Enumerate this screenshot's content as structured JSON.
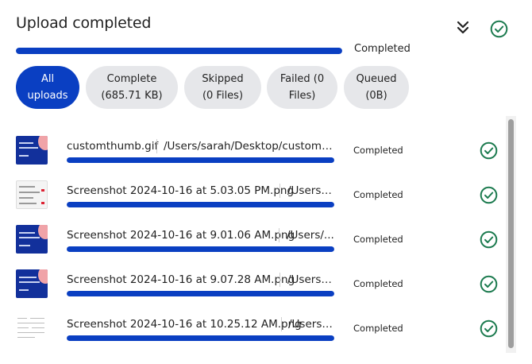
{
  "header": {
    "title": "Upload completed",
    "collapse_icon": "double-chevron-down-icon",
    "status_icon": "check-circle-icon"
  },
  "overall": {
    "progress_percent": 100,
    "status": "Completed"
  },
  "tabs": [
    {
      "line1": "All",
      "line2": "uploads",
      "active": true
    },
    {
      "line1": "Complete",
      "line2": "(685.71 KB)",
      "active": false
    },
    {
      "line1": "Skipped",
      "line2": "(0 Files)",
      "active": false
    },
    {
      "line1": "Failed (0",
      "line2": "Files)",
      "active": false
    },
    {
      "line1": "Queued",
      "line2": "(0B)",
      "active": false
    }
  ],
  "files": [
    {
      "name": "customthumb.gif",
      "path": "/Users/sarah/Desktop/customth...",
      "progress_percent": 100,
      "status": "Completed",
      "icon": "check-circle-icon"
    },
    {
      "name": "Screenshot 2024-10-16 at 5.03.05 PM.png",
      "path": "/Users/...",
      "progress_percent": 100,
      "status": "Completed",
      "icon": "check-circle-icon"
    },
    {
      "name": "Screenshot 2024-10-16 at 9.01.06 AM.png",
      "path": "/Users/...",
      "progress_percent": 100,
      "status": "Completed",
      "icon": "check-circle-icon"
    },
    {
      "name": "Screenshot 2024-10-16 at 9.07.28 AM.png",
      "path": "/Users/s...",
      "progress_percent": 100,
      "status": "Completed",
      "icon": "check-circle-icon"
    },
    {
      "name": "Screenshot 2024-10-16 at 10.25.12 AM.png",
      "path": "/Users/...",
      "progress_percent": 100,
      "status": "Completed",
      "icon": "check-circle-icon"
    }
  ],
  "colors": {
    "accent": "#0a3fc2",
    "success": "#1b7a4e",
    "tab_bg": "#e6e7ea"
  }
}
